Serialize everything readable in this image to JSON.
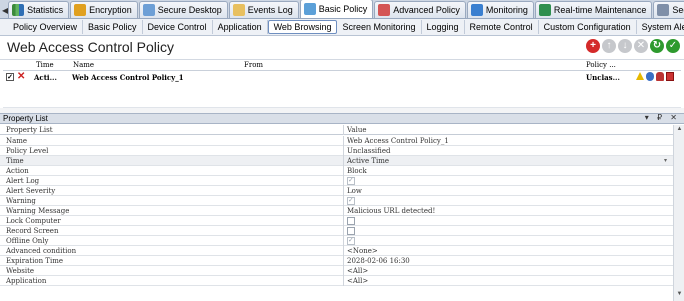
{
  "tabs": [
    {
      "label": "Statistics",
      "icon": "statistics-icon"
    },
    {
      "label": "Encryption",
      "icon": "encryption-icon"
    },
    {
      "label": "Secure Desktop",
      "icon": "secure-desktop-icon"
    },
    {
      "label": "Events Log",
      "icon": "events-log-icon"
    },
    {
      "label": "Basic Policy",
      "icon": "basic-policy-icon"
    },
    {
      "label": "Advanced Policy",
      "icon": "advanced-policy-icon"
    },
    {
      "label": "Monitoring",
      "icon": "monitoring-icon"
    },
    {
      "label": "Real-time Maintenance",
      "icon": "realtime-maintenance-icon"
    },
    {
      "label": "Securit...",
      "icon": "security-icon"
    }
  ],
  "subtabs": [
    "Policy Overview",
    "Basic Policy",
    "Device Control",
    "Application",
    "Web Browsing",
    "Screen Monitoring",
    "Logging",
    "Remote Control",
    "Custom Configuration",
    "System Alert"
  ],
  "page_title": "Web Access Control Policy",
  "policy_grid": {
    "headers": {
      "time": "Time",
      "name": "Name",
      "from": "From",
      "policy": "Policy ..."
    },
    "row": {
      "time": "Acti...",
      "name": "Web Access Control Policy_1",
      "from": "",
      "policy": "Unclas..."
    }
  },
  "property_panel": {
    "title": "Property List",
    "buttons": "▾ ₽ ✕"
  },
  "property_table": {
    "header": {
      "key": "Property List",
      "value": "Value"
    },
    "rows": [
      {
        "key": "Name",
        "value": "Web Access Control Policy_1"
      },
      {
        "key": "Policy Level",
        "value": "Unclassified"
      },
      {
        "key": "Time",
        "value": "Active Time"
      },
      {
        "key": "Action",
        "value": "Block"
      },
      {
        "key": "Alert Log",
        "value": ""
      },
      {
        "key": "Alert Severity",
        "value": "Low"
      },
      {
        "key": "Warning",
        "value": ""
      },
      {
        "key": "Warning Message",
        "value": "Malicious URL detected!"
      },
      {
        "key": "Lock Computer",
        "value": ""
      },
      {
        "key": "Record Screen",
        "value": ""
      },
      {
        "key": "Offline Only",
        "value": ""
      },
      {
        "key": "Advanced condition",
        "value": "<None>"
      },
      {
        "key": "Expiration Time",
        "value": "2028-02-06 16:30"
      },
      {
        "key": "Website",
        "value": "<All>"
      },
      {
        "key": "Application",
        "value": "<All>"
      }
    ]
  },
  "colors": {
    "accent": "#2e9a2e",
    "danger": "#d42a2a"
  }
}
